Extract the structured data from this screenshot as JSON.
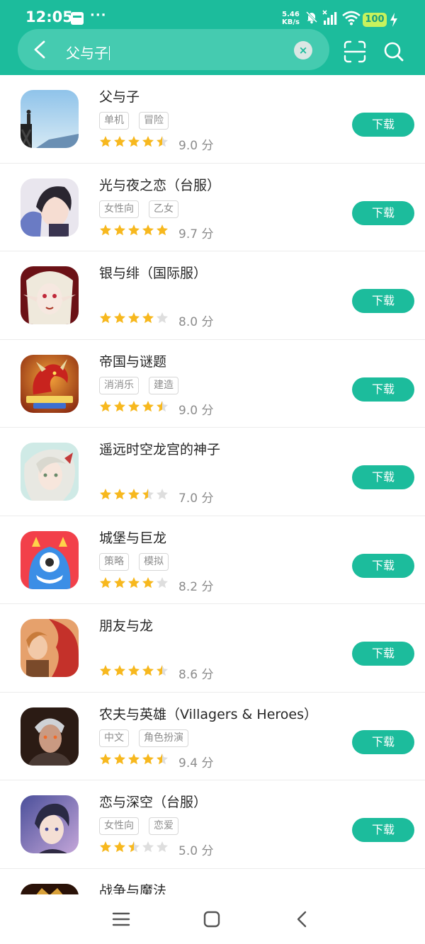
{
  "status_bar": {
    "time": "12:05",
    "net_speed_value": "5.46",
    "net_speed_unit": "KB/s",
    "battery": "100",
    "icons": [
      "calendar-icon",
      "more-dots-icon",
      "mute-bell-icon",
      "signal-icon",
      "wifi-icon",
      "battery-icon",
      "charging-icon"
    ],
    "more_dots": "···"
  },
  "header": {
    "search_query": "父与子",
    "clear_label": "×",
    "background_color": "#1cbc9c",
    "icons": [
      "back-icon",
      "scan-icon",
      "search-icon"
    ]
  },
  "results": [
    {
      "title": "父与子",
      "tags": [
        "单机",
        "冒险"
      ],
      "rating": 4.5,
      "score": "9.0 分",
      "button": "下载",
      "icon_art": "silhouette-cliff"
    },
    {
      "title": "光与夜之恋（台服）",
      "tags": [
        "女性向",
        "乙女"
      ],
      "rating": 5,
      "score": "9.7 分",
      "button": "下载",
      "icon_art": "anime-man-dark-hair"
    },
    {
      "title": "银与绯（国际服）",
      "tags": [],
      "rating": 4,
      "score": "8.0 分",
      "button": "下载",
      "icon_art": "vampire-elf"
    },
    {
      "title": "帝国与谜题",
      "tags": [
        "消消乐",
        "建造"
      ],
      "rating": 4.5,
      "score": "9.0 分",
      "button": "下载",
      "icon_art": "red-dragon-logo"
    },
    {
      "title": "遥远时空龙宫的神子",
      "tags": [],
      "rating": 3.5,
      "score": "7.0 分",
      "button": "下载",
      "icon_art": "anime-silver-hair"
    },
    {
      "title": "城堡与巨龙",
      "tags": [
        "策略",
        "模拟"
      ],
      "rating": 4,
      "score": "8.2 分",
      "button": "下载",
      "icon_art": "blue-monster"
    },
    {
      "title": "朋友与龙",
      "tags": [],
      "rating": 4.5,
      "score": "8.6 分",
      "button": "下载",
      "icon_art": "hero-red-dragon"
    },
    {
      "title": "农夫与英雄（Villagers & Heroes）",
      "tags": [
        "中文",
        "角色扮演"
      ],
      "rating": 4.5,
      "score": "9.4 分",
      "button": "下载",
      "icon_art": "warrior-portrait"
    },
    {
      "title": "恋与深空（台服）",
      "tags": [
        "女性向",
        "恋爱"
      ],
      "rating": 2.5,
      "score": "5.0 分",
      "button": "下载",
      "icon_art": "anime-boy-blue"
    },
    {
      "title": "战争与魔法",
      "tags": [],
      "rating": 0,
      "score": "",
      "button": "",
      "icon_art": "war-magic"
    }
  ],
  "colors": {
    "accent": "#1cbc9c",
    "star_filled": "#f7b81e",
    "star_empty": "#dedede",
    "text_primary": "#262626",
    "text_secondary": "#8c8c8c"
  },
  "nav_bar": {
    "icons": [
      "menu-icon",
      "home-icon",
      "back-nav-icon"
    ]
  }
}
